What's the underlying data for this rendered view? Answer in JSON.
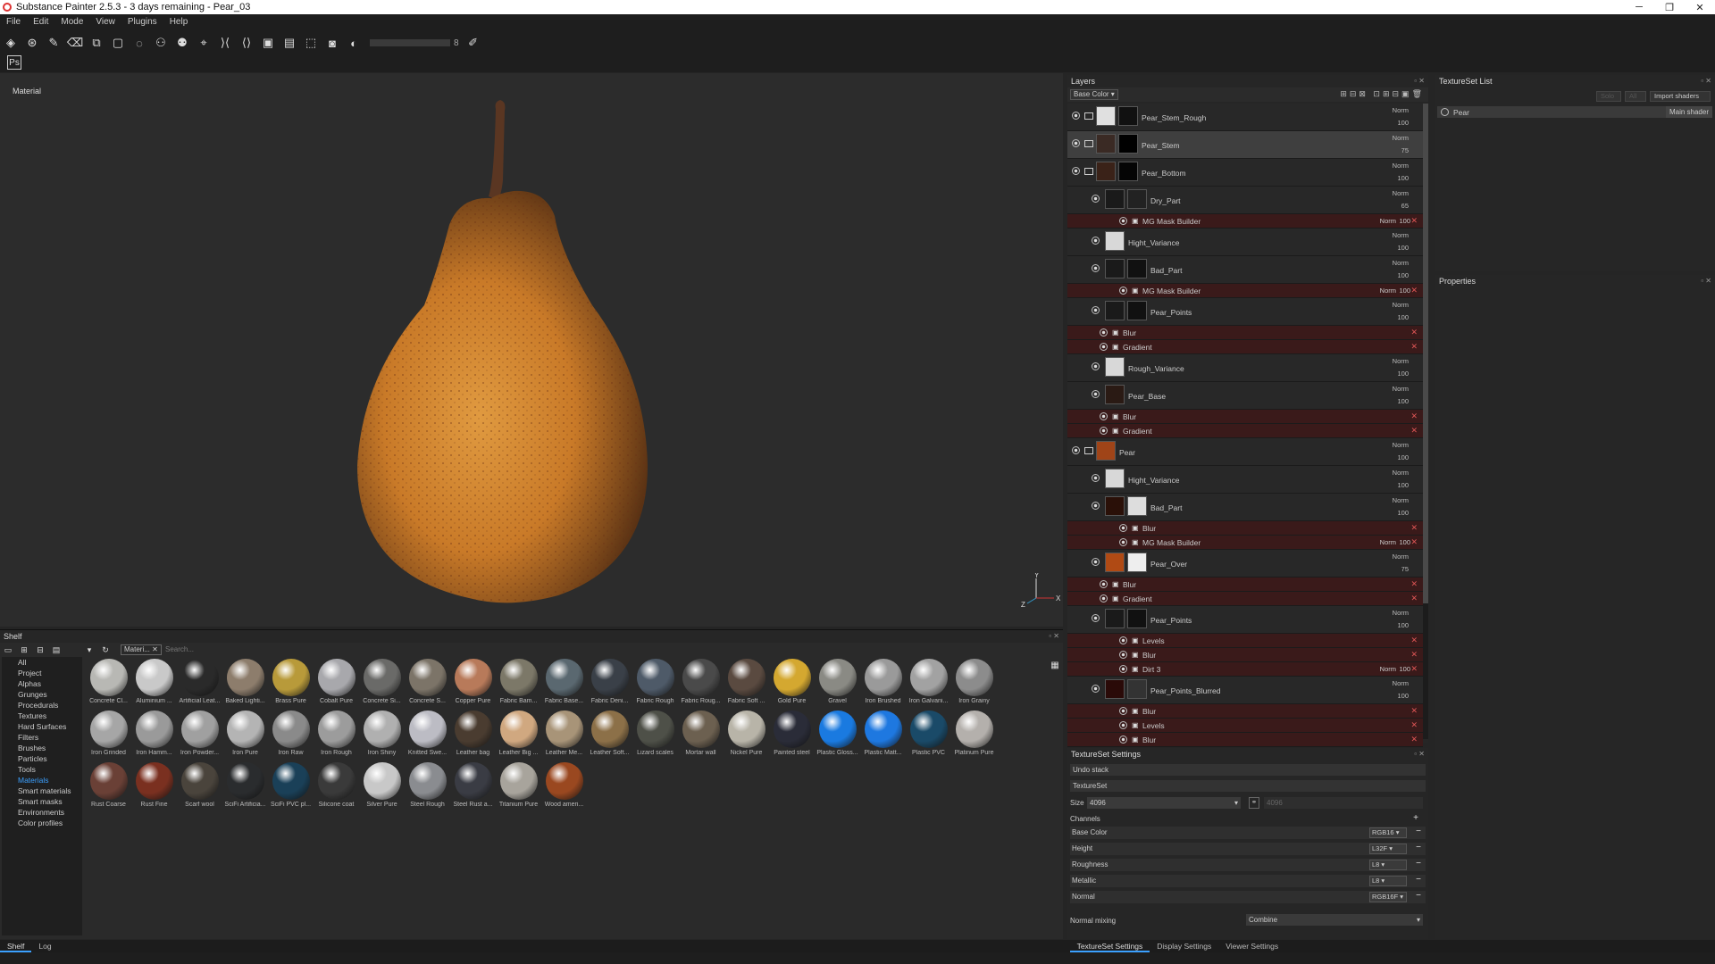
{
  "window": {
    "title": "Substance Painter 2.5.3 - 3 days remaining - Pear_03",
    "min": "─",
    "max": "❐",
    "close": "✕"
  },
  "menu": [
    "File",
    "Edit",
    "Mode",
    "View",
    "Plugins",
    "Help"
  ],
  "toolbar": {
    "size_value": "8"
  },
  "viewport": {
    "label": "Material"
  },
  "shelf": {
    "title": "Shelf",
    "filter_chip": "Materi...",
    "search_placeholder": "Search...",
    "categories": [
      "All",
      "Project",
      "Alphas",
      "Grunges",
      "Procedurals",
      "Textures",
      "Hard Surfaces",
      "Filters",
      "Brushes",
      "Particles",
      "Tools",
      "Materials",
      "Smart materials",
      "Smart masks",
      "Environments",
      "Color profiles"
    ],
    "active_category": "Materials",
    "materials": [
      {
        "name": "Concrete Cl...",
        "color": "#b8b8b4"
      },
      {
        "name": "Aluminium ...",
        "color": "#c9c9c9"
      },
      {
        "name": "Artificial Leat...",
        "color": "#2a2a2a"
      },
      {
        "name": "Baked Lighti...",
        "color": "#8d7d6c"
      },
      {
        "name": "Brass Pure",
        "color": "#b89a3a"
      },
      {
        "name": "Cobalt Pure",
        "color": "#a8a8ac"
      },
      {
        "name": "Concrete Si...",
        "color": "#6a6a68"
      },
      {
        "name": "Concrete S...",
        "color": "#7c7468"
      },
      {
        "name": "Copper Pure",
        "color": "#b87a5a"
      },
      {
        "name": "Fabric Bam...",
        "color": "#7c7868"
      },
      {
        "name": "Fabric Base...",
        "color": "#5a6870"
      },
      {
        "name": "Fabric Deni...",
        "color": "#3a4048"
      },
      {
        "name": "Fabric Rough",
        "color": "#4e5a68"
      },
      {
        "name": "Fabric Roug...",
        "color": "#4a4a4a"
      },
      {
        "name": "Fabric Soft ...",
        "color": "#5a4a40"
      },
      {
        "name": "Gold Pure",
        "color": "#d4a830"
      },
      {
        "name": "Gravel",
        "color": "#8a8a84"
      },
      {
        "name": "Iron Brushed",
        "color": "#9a9a9a"
      },
      {
        "name": "Iron Galvani...",
        "color": "#a2a2a2"
      },
      {
        "name": "Iron Grainy",
        "color": "#8c8c8c"
      },
      {
        "name": "Iron Grinded",
        "color": "#a6a6a6"
      },
      {
        "name": "Iron Hamm...",
        "color": "#9a9a9a"
      },
      {
        "name": "Iron Powder...",
        "color": "#a0a0a0"
      },
      {
        "name": "Iron Pure",
        "color": "#b4b4b4"
      },
      {
        "name": "Iron Raw",
        "color": "#8a8a8a"
      },
      {
        "name": "Iron Rough",
        "color": "#9c9c9c"
      },
      {
        "name": "Iron Shiny",
        "color": "#b0b0b0"
      },
      {
        "name": "Knitted Swe...",
        "color": "#bcbcc4"
      },
      {
        "name": "Leather bag",
        "color": "#4a3c30"
      },
      {
        "name": "Leather Big ...",
        "color": "#d0a880"
      },
      {
        "name": "Leather Me...",
        "color": "#a89478"
      },
      {
        "name": "Leather Soft...",
        "color": "#8c7048"
      },
      {
        "name": "Lizard scales",
        "color": "#4e5048"
      },
      {
        "name": "Mortar wall",
        "color": "#6c6050"
      },
      {
        "name": "Nickel Pure",
        "color": "#b8b4a8"
      },
      {
        "name": "Painted steel",
        "color": "#2a2c38"
      },
      {
        "name": "Plastic Gloss...",
        "color": "#1a7ae0"
      },
      {
        "name": "Plastic Matt...",
        "color": "#1e78e0"
      },
      {
        "name": "Plastic PVC",
        "color": "#1a4a68"
      },
      {
        "name": "Platinum Pure",
        "color": "#b4b0ac"
      },
      {
        "name": "Rust Coarse",
        "color": "#6a4036"
      },
      {
        "name": "Rust Fine",
        "color": "#7a3020"
      },
      {
        "name": "Scarf wool",
        "color": "#4a443c"
      },
      {
        "name": "SciFi Artificia...",
        "color": "#2a2c2e"
      },
      {
        "name": "SciFi PVC pl...",
        "color": "#1a4058"
      },
      {
        "name": "Silicone coat",
        "color": "#3a3a3a"
      },
      {
        "name": "Silver Pure",
        "color": "#c8c8c8"
      },
      {
        "name": "Steel Rough",
        "color": "#8a8c90"
      },
      {
        "name": "Steel Rust a...",
        "color": "#3a3c44"
      },
      {
        "name": "Titanium Pure",
        "color": "#a8a49c"
      },
      {
        "name": "Wood ameri...",
        "color": "#9a4820"
      }
    ]
  },
  "bottom_tabs": {
    "left": [
      "Shelf",
      "Log"
    ],
    "right": [
      "TextureSet Settings",
      "Display Settings",
      "Viewer Settings"
    ]
  },
  "layers": {
    "title": "Layers",
    "channel": "Base Color",
    "rows": [
      {
        "type": "layer",
        "name": "Pear_Stem_Rough",
        "blend": "Norm",
        "opacity": "100",
        "indent": 0,
        "folder": true,
        "thumb": "#e0e0e0",
        "mask": "#111"
      },
      {
        "type": "layer",
        "name": "Pear_Stem",
        "blend": "Norm",
        "opacity": "75",
        "indent": 0,
        "folder": true,
        "selected": true,
        "thumb": "#3a2a24",
        "mask": "#000"
      },
      {
        "type": "layer",
        "name": "Pear_Bottom",
        "blend": "Norm",
        "opacity": "100",
        "indent": 0,
        "folder": true,
        "thumb": "#3a2218",
        "mask": "#050505"
      },
      {
        "type": "layer",
        "name": "Dry_Part",
        "blend": "Norm",
        "opacity": "65",
        "indent": 1,
        "thumb": "#1a1a1a",
        "mask": "#222"
      },
      {
        "type": "fx",
        "name": "MG Mask Builder",
        "blend": "Norm",
        "opacity": "100",
        "indent": 2
      },
      {
        "type": "layer",
        "name": "Hight_Variance",
        "blend": "Norm",
        "opacity": "100",
        "indent": 1,
        "thumb": "#d8d8d8"
      },
      {
        "type": "layer",
        "name": "Bad_Part",
        "blend": "Norm",
        "opacity": "100",
        "indent": 1,
        "thumb": "#1a1a1a",
        "mask": "#111"
      },
      {
        "type": "fx",
        "name": "MG Mask Builder",
        "blend": "Norm",
        "opacity": "100",
        "indent": 2
      },
      {
        "type": "layer",
        "name": "Pear_Points",
        "blend": "Norm",
        "opacity": "100",
        "indent": 1,
        "thumb": "#1a1a1a",
        "mask": "#111"
      },
      {
        "type": "fx",
        "name": "Blur",
        "indent": 1
      },
      {
        "type": "fx",
        "name": "Gradient",
        "indent": 1
      },
      {
        "type": "layer",
        "name": "Rough_Variance",
        "blend": "Norm",
        "opacity": "100",
        "indent": 1,
        "thumb": "#d8d8d8"
      },
      {
        "type": "layer",
        "name": "Pear_Base",
        "blend": "Norm",
        "opacity": "100",
        "indent": 1,
        "thumb": "#2a1a14"
      },
      {
        "type": "fx",
        "name": "Blur",
        "indent": 1
      },
      {
        "type": "fx",
        "name": "Gradient",
        "indent": 1
      },
      {
        "type": "layer",
        "name": "Pear",
        "blend": "Norm",
        "opacity": "100",
        "indent": 0,
        "folder": true,
        "thumb": "#a04418"
      },
      {
        "type": "layer",
        "name": "Hight_Variance",
        "blend": "Norm",
        "opacity": "100",
        "indent": 1,
        "thumb": "#d8d8d8"
      },
      {
        "type": "layer",
        "name": "Bad_Part",
        "blend": "Norm",
        "opacity": "100",
        "indent": 1,
        "thumb": "#2a1008",
        "mask": "#ddd"
      },
      {
        "type": "fx",
        "name": "Blur",
        "indent": 2
      },
      {
        "type": "fx",
        "name": "MG Mask Builder",
        "blend": "Norm",
        "opacity": "100",
        "indent": 2
      },
      {
        "type": "layer",
        "name": "Pear_Over",
        "blend": "Norm",
        "opacity": "75",
        "indent": 1,
        "thumb": "#b04a14",
        "mask": "#eee"
      },
      {
        "type": "fx",
        "name": "Blur",
        "indent": 1
      },
      {
        "type": "fx",
        "name": "Gradient",
        "indent": 1
      },
      {
        "type": "layer",
        "name": "Pear_Points",
        "blend": "Norm",
        "opacity": "100",
        "indent": 1,
        "thumb": "#1a1a1a",
        "mask": "#111"
      },
      {
        "type": "fx",
        "name": "Levels",
        "indent": 2
      },
      {
        "type": "fx",
        "name": "Blur",
        "indent": 2
      },
      {
        "type": "fx",
        "name": "Dirt 3",
        "blend": "Norm",
        "opacity": "100",
        "indent": 2
      },
      {
        "type": "layer",
        "name": "Pear_Points_Blurred",
        "blend": "Norm",
        "opacity": "100",
        "indent": 1,
        "thumb": "#2a0a08",
        "mask": "#333"
      },
      {
        "type": "fx",
        "name": "Blur",
        "indent": 2
      },
      {
        "type": "fx",
        "name": "Levels",
        "indent": 2
      },
      {
        "type": "fx",
        "name": "Blur",
        "indent": 2
      }
    ]
  },
  "textureset_list": {
    "title": "TextureSet List",
    "solo": "Solo",
    "all": "All",
    "import_shaders": "Import shaders",
    "item": "Pear",
    "shader": "Main shader"
  },
  "properties": {
    "title": "Properties"
  },
  "textureset_settings": {
    "title": "TextureSet Settings",
    "undo_stack": "Undo stack",
    "textureset": "TextureSet",
    "size_label": "Size",
    "size_value": "4096",
    "size_value2": "4096",
    "channels_label": "Channels",
    "channels": [
      {
        "name": "Base Color",
        "format": "RGB16"
      },
      {
        "name": "Height",
        "format": "L32F"
      },
      {
        "name": "Roughness",
        "format": "L8"
      },
      {
        "name": "Metallic",
        "format": "L8"
      },
      {
        "name": "Normal",
        "format": "RGB16F"
      }
    ],
    "normal_mixing_label": "Normal mixing",
    "normal_mixing_value": "Combine"
  }
}
